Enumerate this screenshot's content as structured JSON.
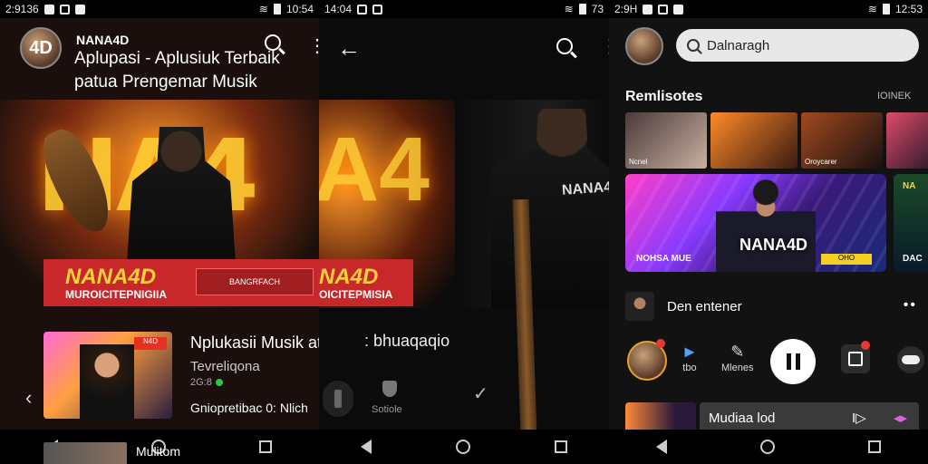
{
  "panel1": {
    "status": {
      "time": "2:9136",
      "clock": "10:54"
    },
    "avatar_text": "4D",
    "brand": "NANA4D",
    "title_line1": "Aplupasi - Aplusiuk Terbaik",
    "title_line2": "patua Prengemar Musik",
    "hero_big_text": "NA4",
    "hero_banner_title": "NANA4D",
    "hero_banner_sub": "MUROICITEPNIGIIA",
    "hero_banner_tag": "BANGRFACH",
    "song_title": "Nplukasii Musik atu",
    "song_artist": "Tevreliqona",
    "song_meta": "2G:8",
    "song_extra": "Gniopretibac 0: Nlich",
    "thumb_badge": "N4D",
    "nav_label": "Mulitom"
  },
  "panel2": {
    "status": {
      "time": "14:04",
      "clock": "73"
    },
    "hero_big_text": "A4",
    "banner_title": "NA4D",
    "banner_sub": "OICITEPMISIA",
    "shirt_text": "NANA4",
    "song_title": ": bhuaqaqio",
    "shield_label": "Sotiole"
  },
  "panel3": {
    "status": {
      "time": "2:9H",
      "clock": "12:53"
    },
    "search_value": "Dalnaragh",
    "section_title": "Remlisotes",
    "section_right": "IOINEK",
    "tiles": [
      {
        "label": "Ncnel",
        "w": 90,
        "c1": "#4a3a3a",
        "c2": "#c9b0a0"
      },
      {
        "label": "",
        "w": 96,
        "c1": "#ff8a2a",
        "c2": "#3a1a10"
      },
      {
        "label": "Oroycarer",
        "w": 90,
        "c1": "#a04a20",
        "c2": "#1a1010"
      },
      {
        "label": "",
        "w": 52,
        "c1": "#e04a6a",
        "c2": "#2a1a2a"
      }
    ],
    "featured_name": "NANA4D",
    "featured_label": "NOHSA MUE",
    "featured_badge": "OHO",
    "featured_side_top": "NA",
    "featured_side_bottom": "DAC",
    "queue_text": "Den entener",
    "player_items": [
      {
        "label": "tbo",
        "icon": "►"
      },
      {
        "label": "Mlenes",
        "icon": "✎"
      }
    ],
    "player_badge": "4",
    "bottom_title": "Mudiaa lod",
    "bottom_icon": "I▷",
    "bottom_icon2": "◂▸"
  }
}
